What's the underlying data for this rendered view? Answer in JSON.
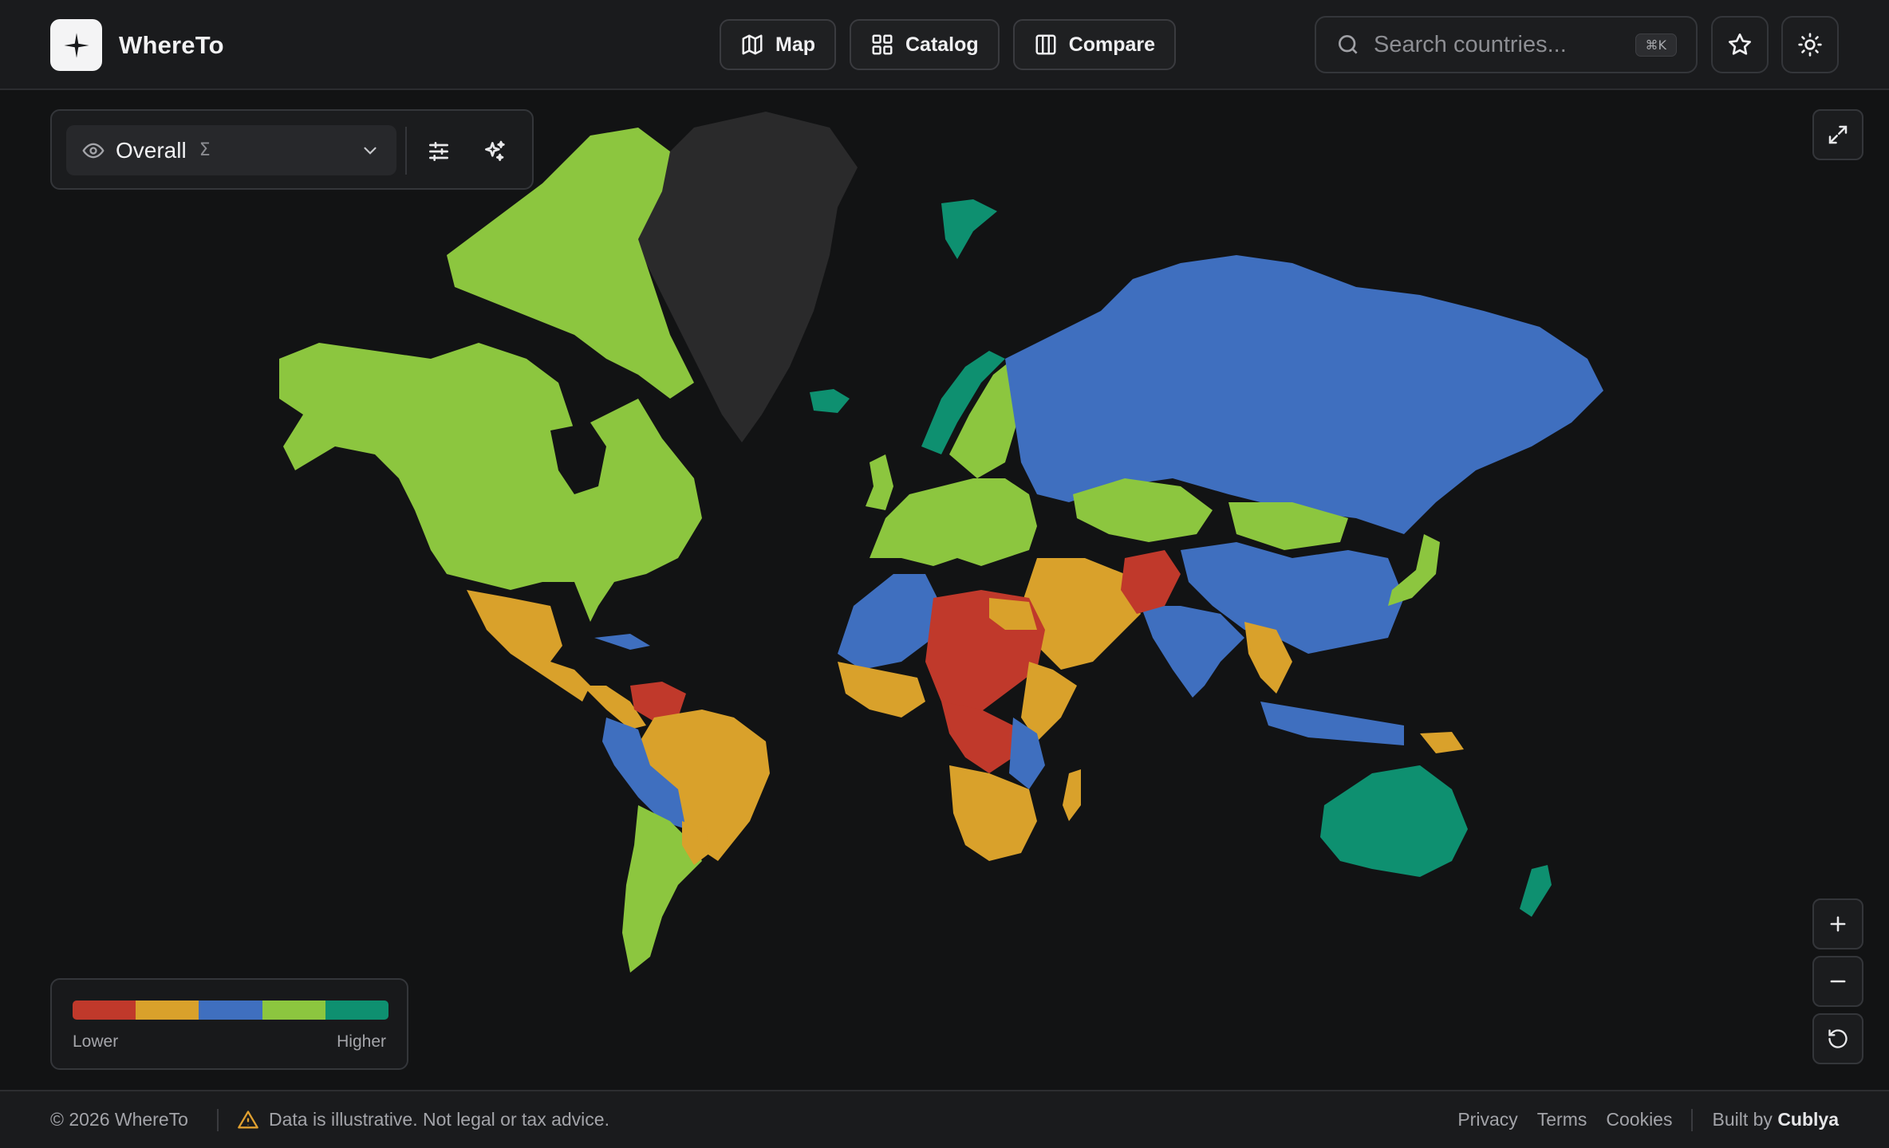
{
  "app": {
    "name": "WhereTo"
  },
  "nav": {
    "items": [
      {
        "label": "Map",
        "icon": "map-icon"
      },
      {
        "label": "Catalog",
        "icon": "grid-icon"
      },
      {
        "label": "Compare",
        "icon": "columns-icon"
      }
    ]
  },
  "search": {
    "placeholder": "Search countries...",
    "shortcut": "⌘K"
  },
  "metric": {
    "selected": "Overall",
    "symbol": "Σ"
  },
  "legend": {
    "low_label": "Lower",
    "high_label": "Higher",
    "colors": [
      "#c0392b",
      "#d9a12b",
      "#3f6fbf",
      "#8cc63f",
      "#0e9070"
    ]
  },
  "footer": {
    "copyright": "© 2026 WhereTo",
    "disclaimer": "Data is illustrative. Not legal or tax advice.",
    "links": [
      "Privacy",
      "Terms",
      "Cookies"
    ],
    "built_prefix": "Built by",
    "built_by": "Cublya"
  }
}
